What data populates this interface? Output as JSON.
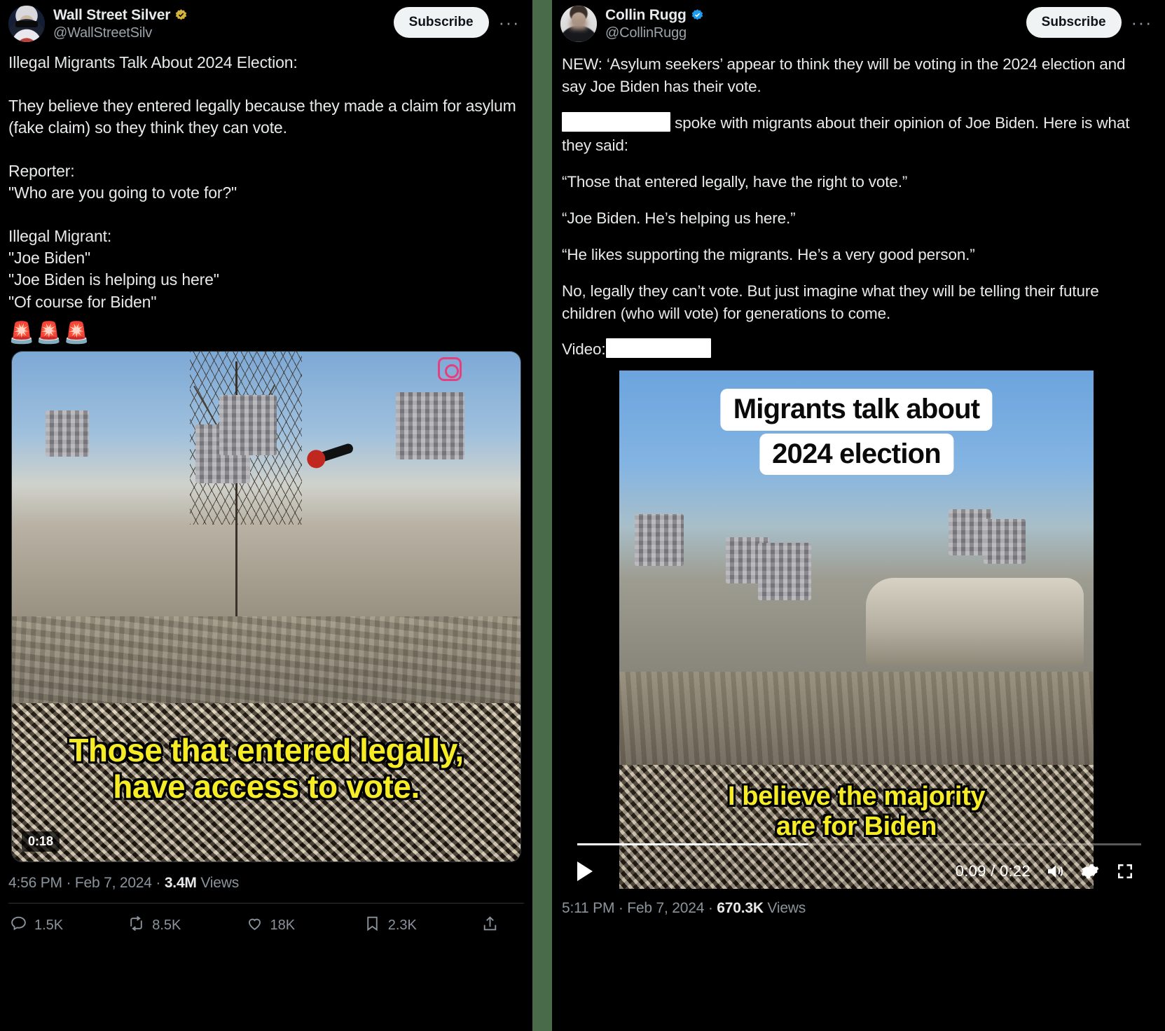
{
  "left_tweet": {
    "display_name": "Wall Street Silver",
    "handle": "@WallStreetSilv",
    "verified_badge": "gold-verified-icon",
    "subscribe_label": "Subscribe",
    "more_label": "···",
    "body_part1": "Illegal Migrants Talk About 2024 Election:\n\nThey believe they entered legally because they made a claim for asylum (fake claim) so they think they can vote.\n\nReporter:\n\"Who are you going to vote for?\"\n\nIllegal Migrant:\n\"Joe Biden\"\n\"Joe Biden is helping us here\"\n\"Of course for Biden\"",
    "emoji_row": "🚨🚨🚨",
    "video": {
      "caption": "Those that entered legally, have access to vote.",
      "duration_chip": "0:18",
      "source_badge": "instagram-icon"
    },
    "timestamp": "4:56 PM · Feb 7, 2024 · ",
    "views_count": "3.4M",
    "views_label": " Views",
    "actions": {
      "reply": "1.5K",
      "retweet": "8.5K",
      "like": "18K",
      "bookmark": "2.3K",
      "share": ""
    }
  },
  "right_tweet": {
    "display_name": "Collin Rugg",
    "handle": "@CollinRugg",
    "verified_badge": "blue-verified-icon",
    "subscribe_label": "Subscribe",
    "more_label": "···",
    "body_line1": "NEW: ‘Asylum seekers’ appear to think they will be voting in the 2024 election and say Joe Biden has their vote.",
    "body_line2_after_redaction": " spoke with migrants about their opinion of Joe Biden. Here is what they said:",
    "body_line3": "“Those that entered legally, have the right to vote.”",
    "body_line4": "“Joe Biden. He’s helping us here.”",
    "body_line5": "“He likes supporting the migrants. He’s a very good person.”",
    "body_line6": "No, legally they can’t vote. But just imagine what they will be telling their future children (who will vote) for generations to come.",
    "video_label": "Video:",
    "video": {
      "overlay_title_line1": "Migrants talk about",
      "overlay_title_line2": "2024 election",
      "caption_line1": "I believe the majority",
      "caption_line2": "are for Biden",
      "current_time": "0:09",
      "time_separator": " / ",
      "total_time": "0:22",
      "play_icon": "play-icon",
      "volume_icon": "volume-icon",
      "settings_icon": "gear-icon",
      "fullscreen_icon": "expand-icon"
    },
    "timestamp": "5:11 PM · Feb 7, 2024 · ",
    "views_count": "670.3K",
    "views_label": " Views"
  },
  "colors": {
    "background": "#000000",
    "page_backdrop": "#4a6b4a",
    "text_primary": "#e7e9ea",
    "text_secondary": "#8b949c",
    "caption_yellow": "#f5ec25",
    "verified_blue": "#1d9bf0",
    "verified_gold": "#d4b33a",
    "subscribe_bg": "#eff3f4"
  }
}
